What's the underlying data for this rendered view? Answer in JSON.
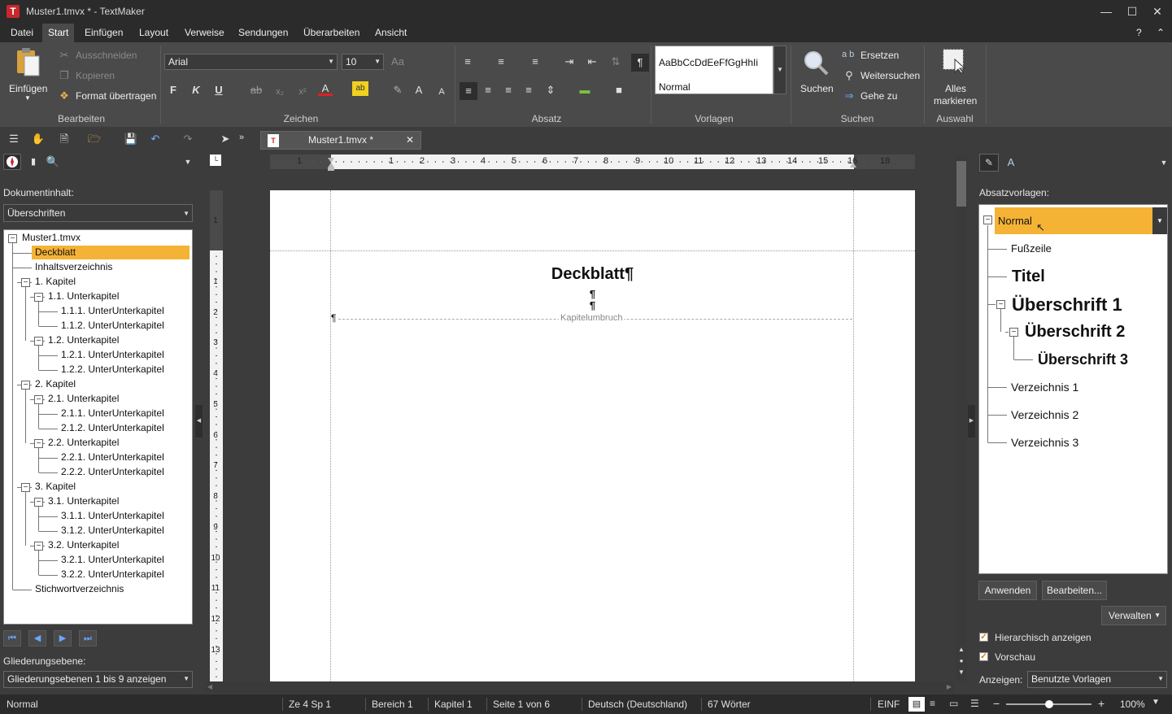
{
  "window": {
    "title": "Muster1.tmvx * - TextMaker",
    "app_letter": "T"
  },
  "menu": [
    "Datei",
    "Start",
    "Einfügen",
    "Layout",
    "Verweise",
    "Sendungen",
    "Überarbeiten",
    "Ansicht"
  ],
  "ribbon": {
    "einfuegen": "Einfügen",
    "ausschneiden": "Ausschneiden",
    "kopieren": "Kopieren",
    "format": "Format übertragen",
    "font": "Arial",
    "size": "10",
    "style_preview": "AaBbCcDdEeFfGgHhIi",
    "style_name": "Normal",
    "suchen": "Suchen",
    "ersetzen": "Ersetzen",
    "weitersuchen": "Weitersuchen",
    "gehezu": "Gehe zu",
    "alles1": "Alles",
    "alles2": "markieren",
    "groups": [
      "Bearbeiten",
      "Zeichen",
      "Absatz",
      "Vorlagen",
      "Suchen",
      "Auswahl"
    ],
    "bold": "F",
    "italic": "K",
    "underline": "U",
    "ab": "a b"
  },
  "doc_tab": "Muster1.tmvx *",
  "left": {
    "label": "Dokumentinhalt:",
    "mode": "Überschriften",
    "tree": [
      "Muster1.tmvx",
      "Deckblatt",
      "Inhaltsverzeichnis",
      "1. Kapitel",
      "1.1. Unterkapitel",
      "1.1.1. UnterUnterkapitel",
      "1.1.2. UnterUnterkapitel",
      "1.2. Unterkapitel",
      "1.2.1. UnterUnterkapitel",
      "1.2.2. UnterUnterkapitel",
      "2. Kapitel",
      "2.1. Unterkapitel",
      "2.1.1. UnterUnterkapitel",
      "2.1.2. UnterUnterkapitel",
      "2.2. Unterkapitel",
      "2.2.1. UnterUnterkapitel",
      "2.2.2. UnterUnterkapitel",
      "3. Kapitel",
      "3.1. Unterkapitel",
      "3.1.1. UnterUnterkapitel",
      "3.1.2. UnterUnterkapitel",
      "3.2. Unterkapitel",
      "3.2.1. UnterUnterkapitel",
      "3.2.2. UnterUnterkapitel",
      "Stichwortverzeichnis"
    ],
    "levels_label": "Gliederungsebene:",
    "levels_value": "Gliederungsebenen 1 bis 9 anzeigen"
  },
  "ruler_h": [
    "1",
    "1",
    "2",
    "3",
    "4",
    "5",
    "6",
    "7",
    "8",
    "9",
    "10",
    "11",
    "12",
    "13",
    "14",
    "15",
    "16",
    "18"
  ],
  "ruler_v": [
    "1",
    "1",
    "2",
    "3",
    "4",
    "5",
    "6",
    "7",
    "8",
    "9",
    "10",
    "11",
    "12",
    "13"
  ],
  "doc": {
    "heading": "Deckblatt¶",
    "pilcrow": "¶",
    "break_label": "Kapitelumbruch"
  },
  "right": {
    "label": "Absatzvorlagen:",
    "styles": [
      "Normal",
      "Fußzeile",
      "Titel",
      "Überschrift 1",
      "Überschrift 2",
      "Überschrift 3",
      "Verzeichnis 1",
      "Verzeichnis 2",
      "Verzeichnis 3"
    ],
    "apply": "Anwenden",
    "edit": "Bearbeiten...",
    "manage": "Verwalten",
    "hier": "Hierarchisch anzeigen",
    "preview": "Vorschau",
    "show_label": "Anzeigen:",
    "show_value": "Benutzte Vorlagen"
  },
  "status": {
    "style": "Normal",
    "pos": "Ze 4 Sp 1",
    "area": "Bereich 1",
    "chapter": "Kapitel 1",
    "page": "Seite 1 von 6",
    "lang": "Deutsch (Deutschland)",
    "words": "67 Wörter",
    "mode": "EINF",
    "zoom": "100%"
  },
  "colors": {
    "accent": "#f5b335",
    "bg": "#3c3c3c",
    "ribbon": "#4a4a4a"
  }
}
